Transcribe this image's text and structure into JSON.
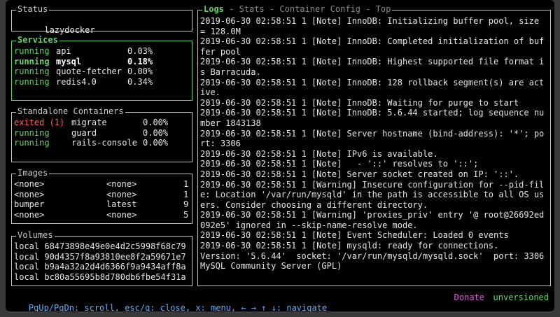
{
  "status": {
    "title": "Status",
    "project": "lazydocker"
  },
  "services": {
    "title": "Services",
    "items": [
      {
        "state": "running",
        "name": "api",
        "cpu": "0.03%"
      },
      {
        "state": "running",
        "name": "mysql",
        "cpu": "0.18%"
      },
      {
        "state": "running",
        "name": "quote-fetcher",
        "cpu": "0.00%"
      },
      {
        "state": "running",
        "name": "redis4.0",
        "cpu": "0.34%"
      }
    ]
  },
  "standalone": {
    "title": "Standalone Containers",
    "items": [
      {
        "state": "exited (1)",
        "name": "migrate",
        "cpu": "0.00%"
      },
      {
        "state": "running",
        "name": "guard",
        "cpu": "0.00%"
      },
      {
        "state": "running",
        "name": "rails-console",
        "cpu": "0.00%"
      }
    ]
  },
  "images": {
    "title": "Images",
    "items": [
      {
        "name": "<none>",
        "tag": "<none>",
        "size": "1"
      },
      {
        "name": "<none>",
        "tag": "<none>",
        "size": "1"
      },
      {
        "name": "bumper",
        "tag": "latest",
        "size": "9"
      },
      {
        "name": "<none>",
        "tag": "<none>",
        "size": "5"
      }
    ]
  },
  "volumes": {
    "title": "Volumes",
    "items": [
      "local 68473898e49e0e4d2c5998f68c79",
      "local 90d4357f8a93810ee8f2a59671e7",
      "local b9a4a32a2d4d6366f9a9434aff8a",
      "local bc80a55695b8d780db6fbe54f31a"
    ]
  },
  "logs": {
    "tabs": [
      "Logs",
      "Stats",
      "Container Config",
      "Top"
    ],
    "lines": [
      "2019-06-30 02:58:51 1 [Note] InnoDB: Initializing buffer pool, size = 128.0M",
      "2019-06-30 02:58:51 1 [Note] InnoDB: Completed initialization of buffer pool",
      "2019-06-30 02:58:51 1 [Note] InnoDB: Highest supported file format is Barracuda.",
      "2019-06-30 02:58:51 1 [Note] InnoDB: 128 rollback segment(s) are active.",
      "2019-06-30 02:58:51 1 [Note] InnoDB: Waiting for purge to start",
      "2019-06-30 02:58:51 1 [Note] InnoDB: 5.6.44 started; log sequence number 1843138",
      "2019-06-30 02:58:51 1 [Note] Server hostname (bind-address): '*'; port: 3306",
      "2019-06-30 02:58:51 1 [Note] IPv6 is available.",
      "2019-06-30 02:58:51 1 [Note]   - '::' resolves to '::';",
      "2019-06-30 02:58:51 1 [Note] Server socket created on IP: '::'.",
      "2019-06-30 02:58:51 1 [Warning] Insecure configuration for --pid-file: Location '/var/run/mysqld' in the path is accessible to all OS users. Consider choosing a different directory.",
      "2019-06-30 02:58:51 1 [Warning] 'proxies_priv' entry '@ root@26692ed092e5' ignored in --skip-name-resolve mode.",
      "2019-06-30 02:58:51 1 [Note] Event Scheduler: Loaded 0 events",
      "2019-06-30 02:58:51 1 [Note] mysqld: ready for connections.",
      "Version: '5.6.44'  socket: '/var/run/mysqld/mysqld.sock'  port: 3306  MySQL Community Server (GPL)"
    ]
  },
  "statusbar": {
    "hint": "PgUp/PgDn: scroll, esc/q: close, x: menu, ← → ↑ ↓: navigate",
    "donate": "Donate",
    "version": "unversioned"
  }
}
